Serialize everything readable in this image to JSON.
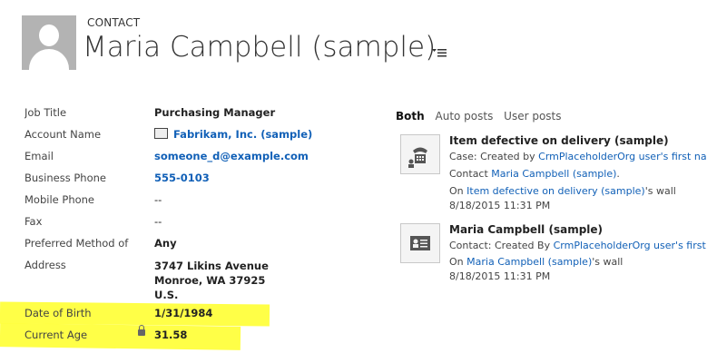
{
  "header": {
    "entity_type": "CONTACT",
    "title": "Maria Campbell (sample)",
    "menu_icon": "chevron-menu-icon"
  },
  "fields": {
    "job_title": {
      "label": "Job Title",
      "value": "Purchasing Manager"
    },
    "account_name": {
      "label": "Account Name",
      "value": "Fabrikam, Inc. (sample)"
    },
    "email": {
      "label": "Email",
      "value": "someone_d@example.com"
    },
    "business_phone": {
      "label": "Business Phone",
      "value": "555-0103"
    },
    "mobile_phone": {
      "label": "Mobile Phone",
      "value": "--"
    },
    "fax": {
      "label": "Fax",
      "value": "--"
    },
    "preferred_method": {
      "label": "Preferred Method of Contact",
      "value": "Any"
    },
    "address": {
      "label": "Address",
      "line1": "3747 Likins Avenue",
      "line2": "Monroe, WA 37925",
      "line3": "U.S."
    },
    "date_of_birth": {
      "label": "Date of Birth",
      "value": "1/31/1984"
    },
    "current_age": {
      "label": "Current Age",
      "value": "31.58"
    }
  },
  "activity": {
    "tabs": [
      "Both",
      "Auto posts",
      "User posts"
    ],
    "active_tab": "Both",
    "posts": [
      {
        "icon": "phone-case-icon",
        "title": "Item defective on delivery (sample)",
        "line1_prefix": "Case: Created by ",
        "line1_link": "CrmPlaceholderOrg user's first name",
        "line2_prefix": "Contact ",
        "line2_link": "Maria Campbell (sample)",
        "line2_suffix": ".",
        "line3_prefix": "On ",
        "line3_link": "Item defective on delivery (sample)",
        "line3_suffix": "'s wall",
        "timestamp": "8/18/2015 11:31 PM"
      },
      {
        "icon": "contact-card-icon",
        "title": "Maria Campbell (sample)",
        "line1_prefix": "Contact: Created By ",
        "line1_link": "CrmPlaceholderOrg user's first name",
        "line3_prefix": "On ",
        "line3_link": "Maria Campbell (sample)",
        "line3_suffix": "'s wall",
        "timestamp": "8/18/2015 11:31 PM"
      }
    ]
  },
  "colors": {
    "link": "#1160b7",
    "highlight": "#ffff33",
    "avatar": "#b3b3b3"
  }
}
